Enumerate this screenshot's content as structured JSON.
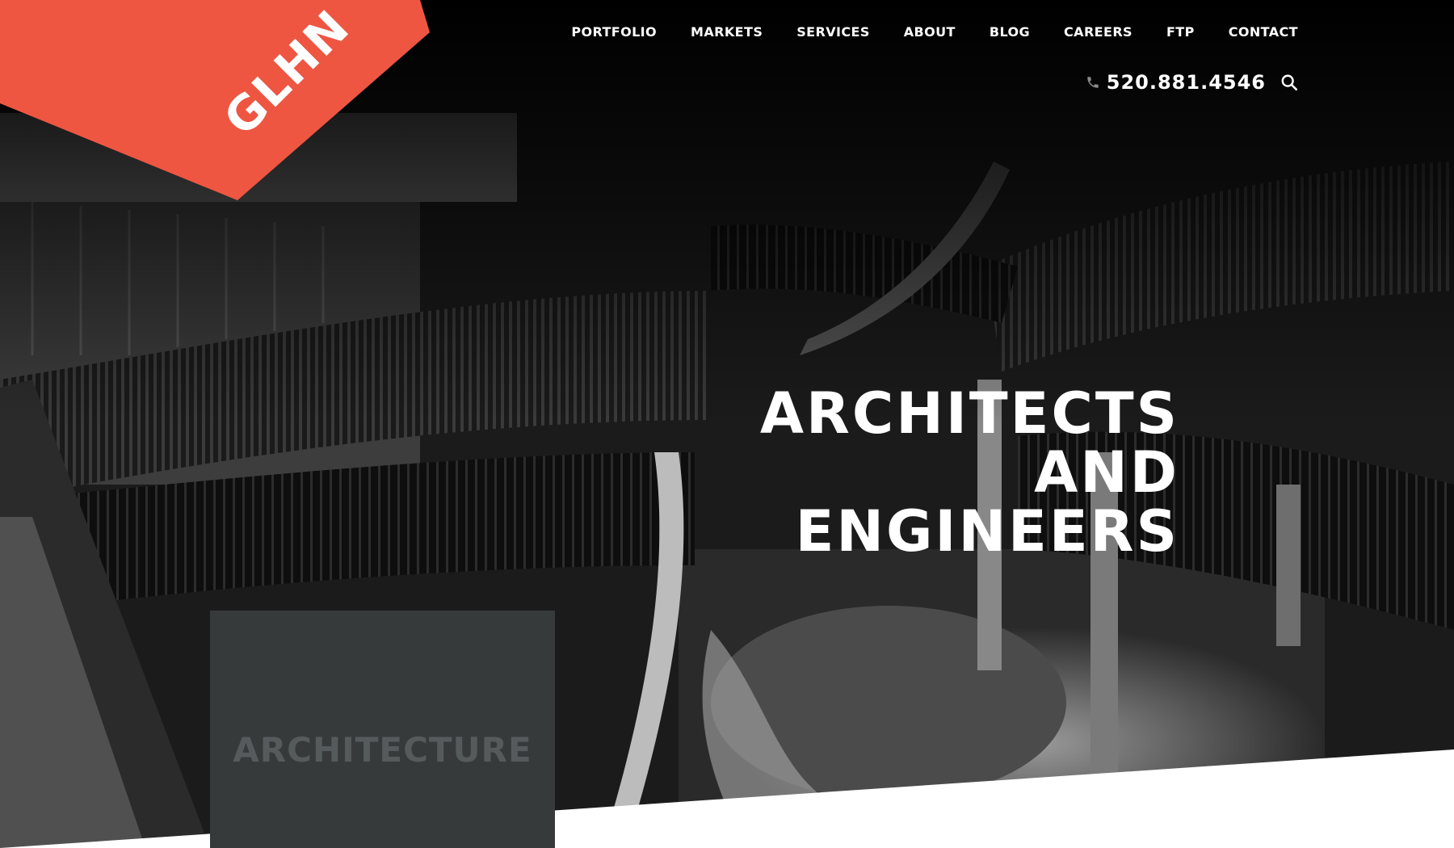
{
  "brand": {
    "logo_text": "GLHN",
    "accent_color": "#ee5642"
  },
  "nav": {
    "items": [
      {
        "label": "PORTFOLIO"
      },
      {
        "label": "MARKETS"
      },
      {
        "label": "SERVICES"
      },
      {
        "label": "ABOUT"
      },
      {
        "label": "BLOG"
      },
      {
        "label": "CAREERS"
      },
      {
        "label": "FTP"
      },
      {
        "label": "CONTACT"
      }
    ]
  },
  "utility": {
    "phone": "520.881.4546",
    "phone_icon": "phone-icon",
    "search_icon": "search-icon"
  },
  "hero": {
    "tagline_lines": [
      "ARCHITECTS",
      "AND",
      "ENGINEERS"
    ]
  },
  "card": {
    "label": "ARCHITECTURE",
    "background": "#363a3b"
  }
}
